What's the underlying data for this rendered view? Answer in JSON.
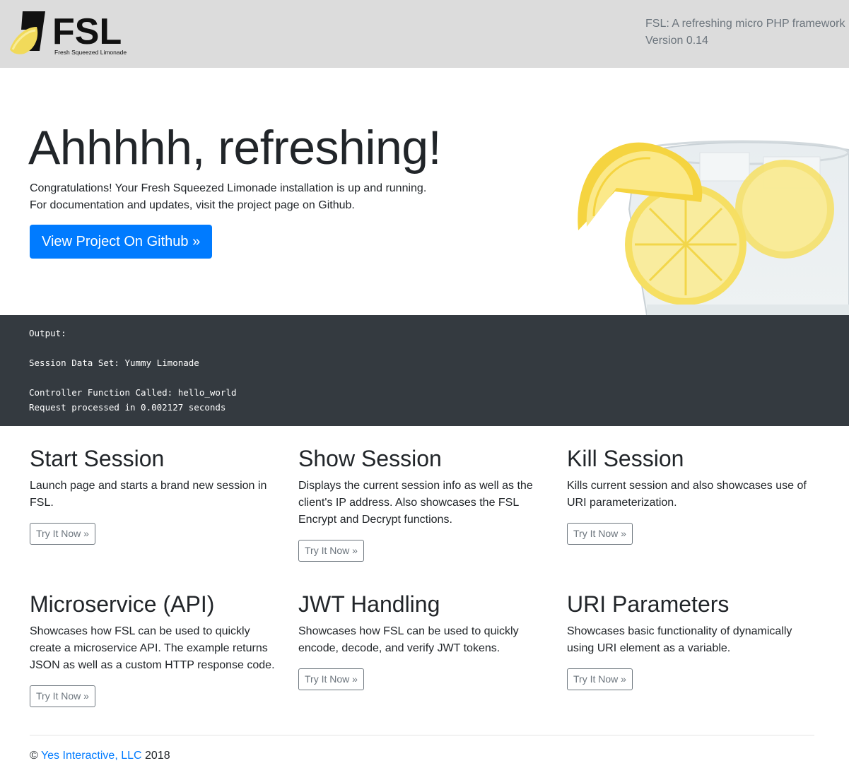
{
  "header": {
    "logo_text": "FSL",
    "logo_tagline": "Fresh Squeezed Limonade",
    "tagline": "FSL: A refreshing micro PHP framework",
    "version": "Version 0.14"
  },
  "hero": {
    "title": "Ahhhhh, refreshing!",
    "line1": "Congratulations! Your Fresh Squeezed Limonade installation is up and running.",
    "line2": "For documentation and updates, visit the project page on Github.",
    "button": "View Project On Github »"
  },
  "output": {
    "heading": "Output:",
    "session_line": "Session Data Set: Yummy Limonade",
    "controller_line": "Controller Function Called: hello_world",
    "request_line": "Request processed in 0.002127 seconds"
  },
  "features": [
    {
      "title": "Start Session",
      "description": "Launch page and starts a brand new session in FSL.",
      "button": "Try It Now »"
    },
    {
      "title": "Show Session",
      "description": "Displays the current session info as well as the client's IP address. Also showcases the FSL Encrypt and Decrypt functions.",
      "button": "Try It Now »"
    },
    {
      "title": "Kill Session",
      "description": "Kills current session and also showcases use of URI parameterization.",
      "button": "Try It Now »"
    },
    {
      "title": "Microservice (API)",
      "description": "Showcases how FSL can be used to quickly create a microservice API. The example returns JSON as well as a custom HTTP response code.",
      "button": "Try It Now »"
    },
    {
      "title": "JWT Handling",
      "description": "Showcases how FSL can be used to quickly encode, decode, and verify JWT tokens.",
      "button": "Try It Now »"
    },
    {
      "title": "URI Parameters",
      "description": "Showcases basic functionality of dynamically using URI element as a variable.",
      "button": "Try It Now »"
    }
  ],
  "footer": {
    "copyright_symbol": "©",
    "company_link": "Yes Interactive, LLC",
    "year": "2018"
  },
  "colors": {
    "header_bg": "#dcdcdc",
    "primary": "#007bff",
    "output_bg": "#343a40",
    "secondary": "#6c757d"
  }
}
